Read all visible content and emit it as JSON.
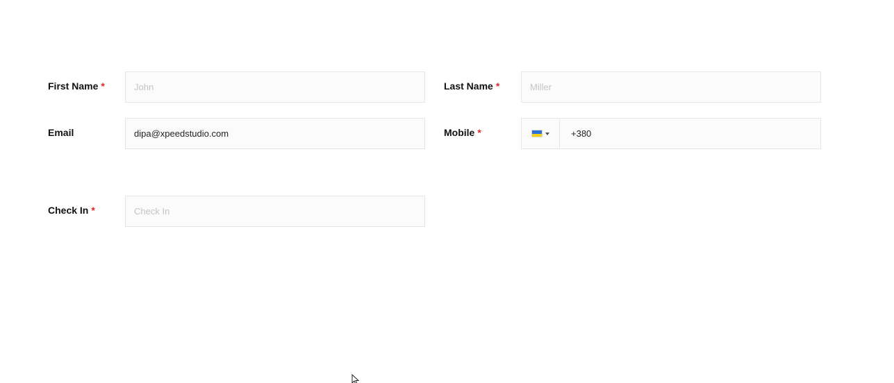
{
  "form": {
    "first_name": {
      "label": "First Name",
      "required_mark": "*",
      "placeholder": "John",
      "value": ""
    },
    "last_name": {
      "label": "Last Name",
      "required_mark": "*",
      "placeholder": "Miller",
      "value": ""
    },
    "email": {
      "label": "Email",
      "value": "dipa@xpeedstudio.com"
    },
    "mobile": {
      "label": "Mobile",
      "required_mark": "*",
      "country_flag": "ukraine-flag-icon",
      "flag_colors": [
        "#2f6fd6",
        "#f7d117"
      ],
      "value": "+380"
    },
    "check_in": {
      "label": "Check In",
      "required_mark": "*",
      "placeholder": "Check In",
      "value": ""
    }
  },
  "colors": {
    "required": "#e02b2b",
    "label": "#111111",
    "field_border": "#e6e6e6",
    "placeholder": "#c4c4c4"
  }
}
